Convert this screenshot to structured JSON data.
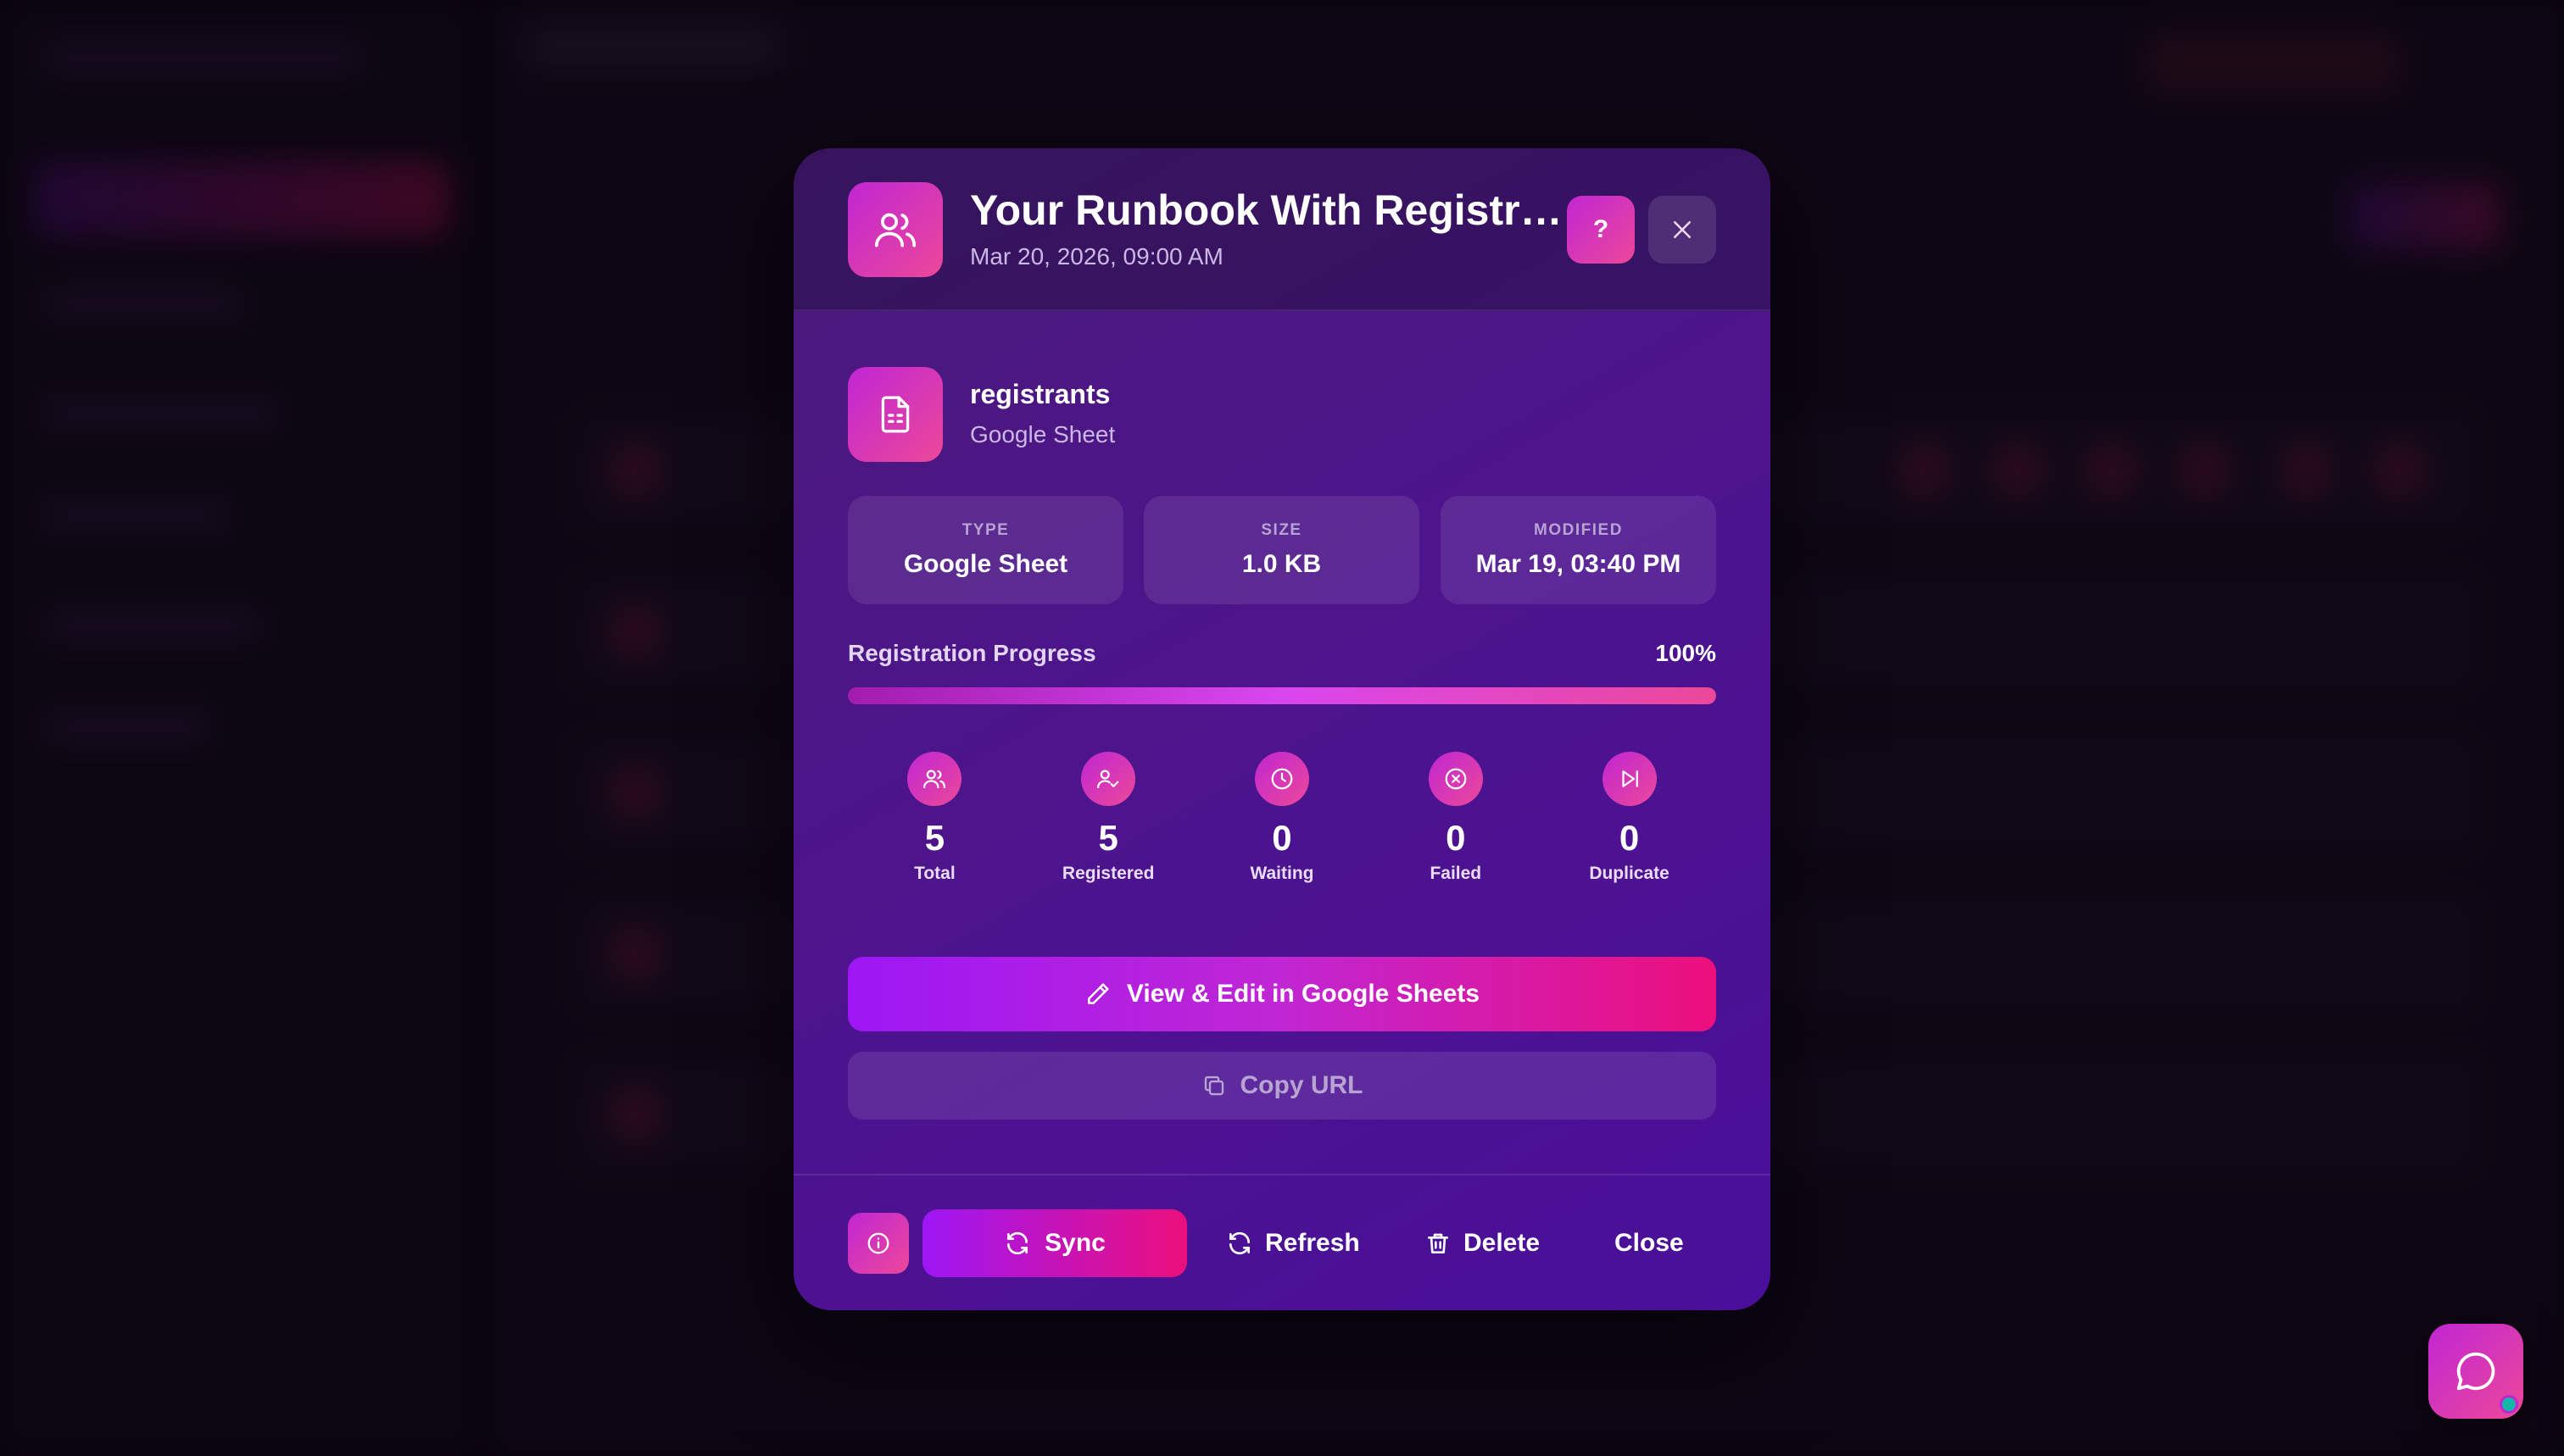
{
  "modal": {
    "title": "Your Runbook With Registrants",
    "subtitle": "Mar 20, 2026, 09:00 AM",
    "help_label": "?"
  },
  "file": {
    "name": "registrants",
    "type": "Google Sheet"
  },
  "info_cards": [
    {
      "label": "TYPE",
      "value": "Google Sheet"
    },
    {
      "label": "SIZE",
      "value": "1.0 KB"
    },
    {
      "label": "MODIFIED",
      "value": "Mar 19, 03:40 PM"
    }
  ],
  "progress": {
    "label": "Registration Progress",
    "percent_text": "100%",
    "value": 1.0
  },
  "stats": [
    {
      "icon": "users-icon",
      "value": "5",
      "label": "Total"
    },
    {
      "icon": "user-check-icon",
      "value": "5",
      "label": "Registered"
    },
    {
      "icon": "clock-icon",
      "value": "0",
      "label": "Waiting"
    },
    {
      "icon": "x-circle-icon",
      "value": "0",
      "label": "Failed"
    },
    {
      "icon": "skip-forward-icon",
      "value": "0",
      "label": "Duplicate"
    }
  ],
  "actions": {
    "view_edit": "View & Edit in Google Sheets",
    "copy_url": "Copy URL"
  },
  "footer": {
    "sync": "Sync",
    "refresh": "Refresh",
    "delete": "Delete",
    "close": "Close"
  },
  "colors": {
    "accent_start": "#9d17f5",
    "accent_end": "#ec0f7c",
    "modal_bg": "#4d148c",
    "online_dot": "#14b8a6"
  }
}
